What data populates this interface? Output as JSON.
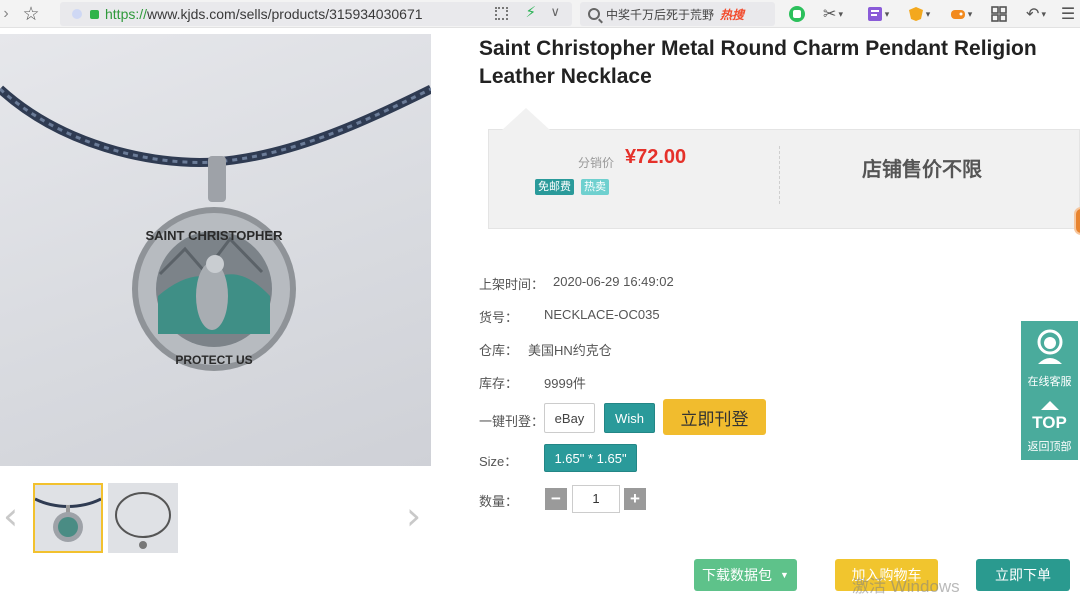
{
  "browser": {
    "url_protocol": "https://",
    "url_rest": "www.kjds.com/sells/products/315934030671",
    "search_text": "中奖千万后死于荒野",
    "search_hot": "热搜"
  },
  "product": {
    "title": "Saint Christopher Metal Round Charm Pendant Religion Leather Necklace",
    "price_label": "分销价",
    "price_value": "¥72.00",
    "badges": [
      "免邮费",
      "热卖"
    ],
    "price_right": "店铺售价不限"
  },
  "details": {
    "listed_label": "上架时间：",
    "listed_value": "2020-06-29 16:49:02",
    "sku_label": "货号：",
    "sku_value": "NECKLACE-OC035",
    "warehouse_label": "仓库：",
    "warehouse_value": "美国HN约克仓",
    "stock_label": "库存：",
    "stock_value": "9999件",
    "publish_label": "一键刊登：",
    "publish_platforms": [
      "eBay",
      "Wish"
    ],
    "publish_button": "立即刊登",
    "size_label": "Size：",
    "size_value": "1.65\" * 1.65\"",
    "qty_label": "数量：",
    "qty_value": "1"
  },
  "pendant_text": {
    "top": "SAINT CHRISTOPHER",
    "bottom": "PROTECT US"
  },
  "actions": {
    "download": "下载数据包",
    "cart": "加入购物车",
    "buy": "立即下单"
  },
  "float_panel": {
    "service": "在线客服",
    "top": "TOP",
    "back_top": "返回顶部"
  },
  "watermark": "激活 Windows",
  "colors": {
    "accent_teal": "#2a9a9a",
    "price_red": "#e5312a",
    "publish_yellow": "#f1bc2e",
    "panel_teal": "#4aab9c"
  }
}
